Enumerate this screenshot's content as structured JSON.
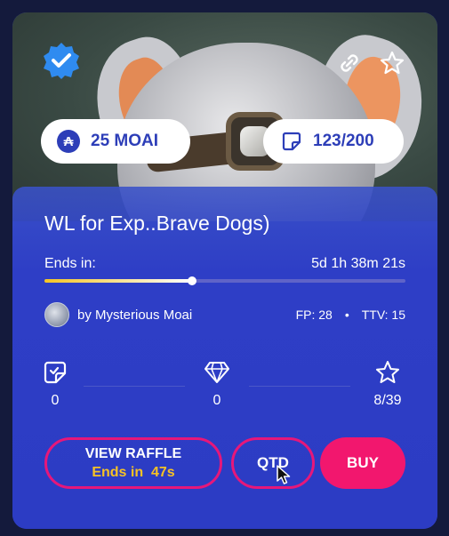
{
  "card": {
    "title": "WL for Exp..Brave Dogs)",
    "price_label": "25 MOAI",
    "count_label": "123/200",
    "ends_label": "Ends in:",
    "ends_value": "5d 1h 38m 21s",
    "progress_fraction": 0.41,
    "creator": "by Mysterious Moai",
    "fp": "FP: 28",
    "ttv": "TTV: 15",
    "separator": "•"
  },
  "stats": {
    "entries": "0",
    "gems": "0",
    "favorites": "8/39"
  },
  "buttons": {
    "view_raffle": "VIEW RAFFLE",
    "view_raffle_sub_label": "Ends in",
    "view_raffle_sub_value": "47s",
    "qtd": "QTD",
    "buy": "BUY"
  },
  "colors": {
    "accent_pink": "#e6177a",
    "accent_yellow": "#f6c225",
    "panel_blue": "#2d3ec4"
  },
  "icons": {
    "verified": "verified-badge-icon",
    "link": "link-icon",
    "star": "star-icon",
    "moai": "moai-token-icon",
    "ticket": "ticket-icon",
    "entries": "ticket-check-icon",
    "gem": "diamond-icon",
    "favorite": "star-outline-icon"
  }
}
